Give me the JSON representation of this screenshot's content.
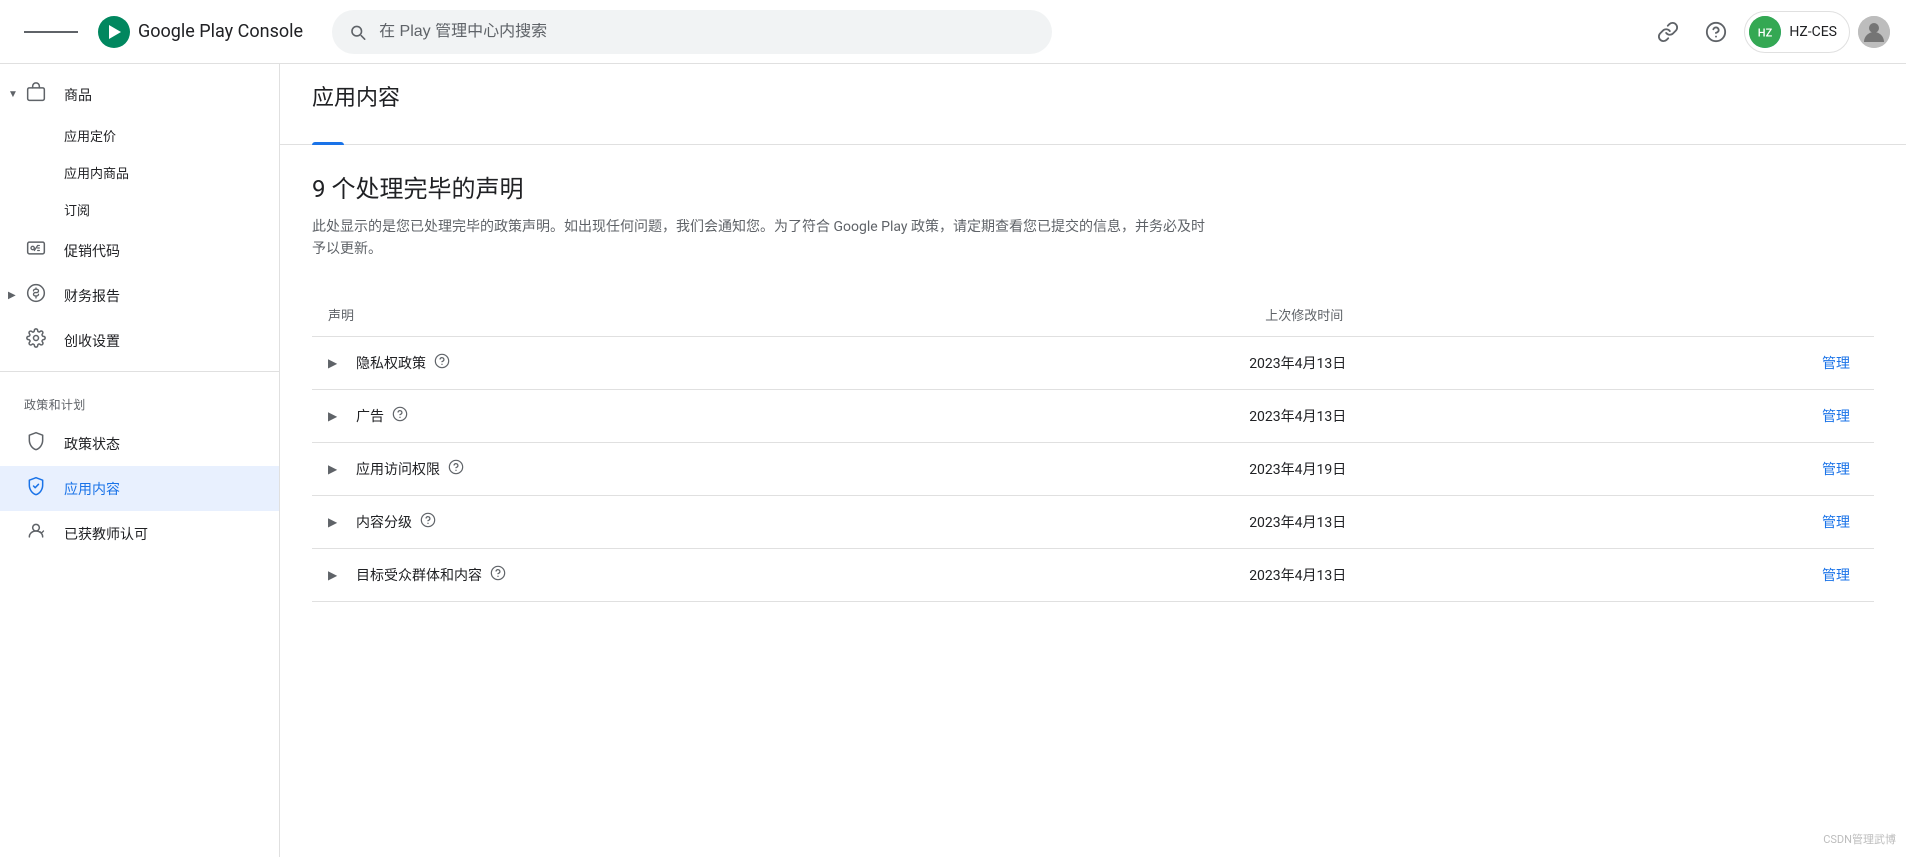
{
  "app": {
    "title": "Google Play Console"
  },
  "header": {
    "menu_icon": "☰",
    "search_placeholder": "在 Play 管理中心内搜索",
    "account_name": "HZ-CES",
    "link_icon": "🔗",
    "help_icon": "?"
  },
  "sidebar": {
    "items": [
      {
        "id": "goods",
        "label": "商品",
        "icon": "🛒",
        "has_arrow": true,
        "level": 0
      },
      {
        "id": "app-pricing",
        "label": "应用定价",
        "icon": "",
        "level": 1
      },
      {
        "id": "in-app-products",
        "label": "应用内商品",
        "icon": "",
        "level": 1
      },
      {
        "id": "subscriptions",
        "label": "订阅",
        "icon": "",
        "level": 1
      },
      {
        "id": "promo-codes",
        "label": "促销代码",
        "icon": "🏷",
        "level": 0
      },
      {
        "id": "financial-reports",
        "label": "财务报告",
        "icon": "💰",
        "level": 0,
        "has_arrow": true
      },
      {
        "id": "monetization-settings",
        "label": "创收设置",
        "icon": "⚙",
        "level": 0
      }
    ],
    "section_policy": "政策和计划",
    "policy_items": [
      {
        "id": "policy-status",
        "label": "政策状态",
        "icon": "shield"
      },
      {
        "id": "app-content",
        "label": "应用内容",
        "icon": "shield-check",
        "active": true
      },
      {
        "id": "teacher-approved",
        "label": "已获教师认可",
        "icon": "badge"
      }
    ]
  },
  "page": {
    "title": "应用内容",
    "tabs": [
      {
        "id": "tab1",
        "label": "",
        "active": true
      },
      {
        "id": "tab2",
        "label": ""
      }
    ],
    "section_title": "9 个处理完毕的声明",
    "section_desc": "此处显示的是您已处理完毕的政策声明。如出现任何问题，我们会通知您。为了符合 Google Play 政策，请定期查看您已提交的信息，并务必及时予以更新。",
    "table": {
      "col_declaration": "声明",
      "col_modified": "上次修改时间",
      "col_action": "",
      "rows": [
        {
          "id": "privacy-policy",
          "title": "隐私权政策",
          "has_help": true,
          "modified": "2023年4月13日",
          "action": "管理"
        },
        {
          "id": "ads",
          "title": "广告",
          "has_help": true,
          "modified": "2023年4月13日",
          "action": "管理"
        },
        {
          "id": "app-access",
          "title": "应用访问权限",
          "has_help": true,
          "modified": "2023年4月19日",
          "action": "管理"
        },
        {
          "id": "content-rating",
          "title": "内容分级",
          "has_help": true,
          "modified": "2023年4月13日",
          "action": "管理"
        },
        {
          "id": "target-audience",
          "title": "目标受众群体和内容",
          "has_help": true,
          "modified": "2023年4月13日",
          "action": "管理"
        }
      ]
    }
  },
  "watermark": "CSDN管理武博"
}
